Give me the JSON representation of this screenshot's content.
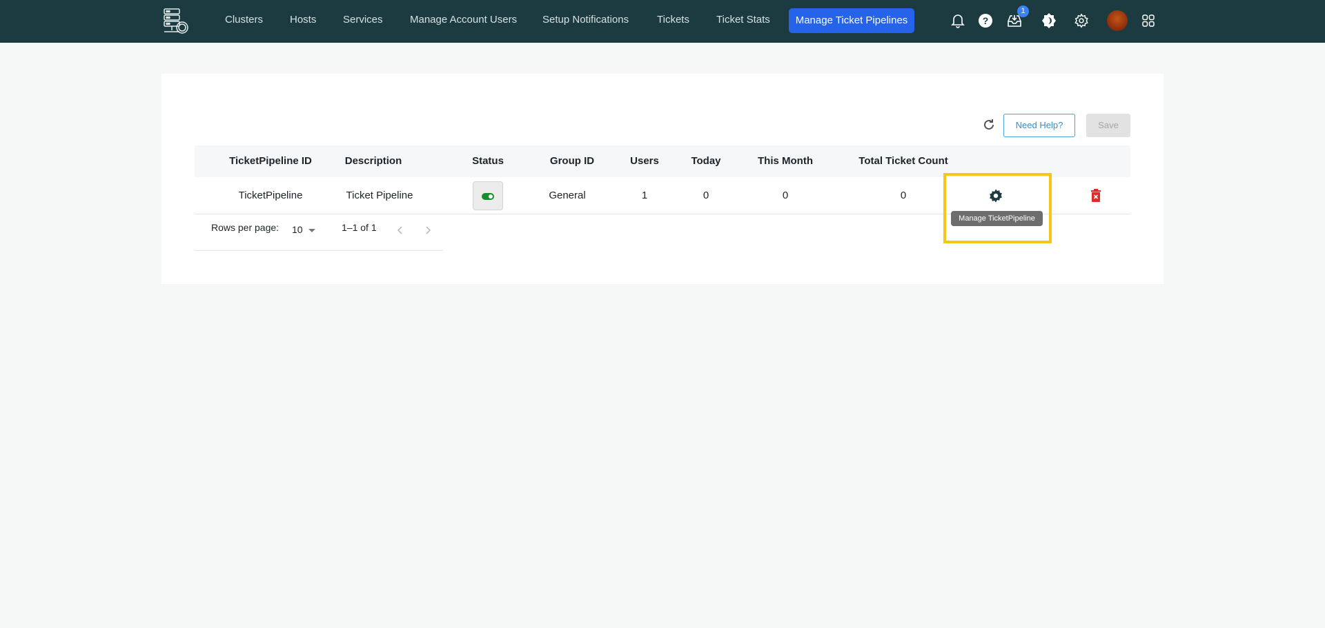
{
  "topbar": {
    "nav": [
      "Clusters",
      "Hosts",
      "Services",
      "Manage Account Users",
      "Setup Notifications",
      "Tickets",
      "Ticket Stats"
    ],
    "active_nav": "Manage Ticket Pipelines",
    "inbox_badge": "1",
    "icons": [
      "bell-icon",
      "help-icon",
      "inbox-icon",
      "theme-toggle-icon",
      "settings-icon",
      "avatar",
      "apps-grid-icon"
    ]
  },
  "toolbar": {
    "help_label": "Need Help?",
    "save_label": "Save"
  },
  "table": {
    "columns": [
      "TicketPipeline ID",
      "Description",
      "Status",
      "Group ID",
      "Users",
      "Today",
      "This Month",
      "Total Ticket Count"
    ],
    "rows": [
      {
        "id": "TicketPipeline",
        "description": "Ticket Pipeline",
        "status_enabled": true,
        "group_id": "General",
        "users": "1",
        "today": "0",
        "this_month": "0",
        "total": "0"
      }
    ],
    "action_tooltip": "Manage TicketPipeline"
  },
  "pagination": {
    "rows_per_page_label": "Rows per page:",
    "rows_per_page": "10",
    "range": "1–1 of 1"
  },
  "colors": {
    "topbar": "#1b3b41",
    "active_nav": "#2563eb",
    "highlight": "#f5c518",
    "toggle_on": "#1a8c2e",
    "delete": "#e02b2b"
  }
}
